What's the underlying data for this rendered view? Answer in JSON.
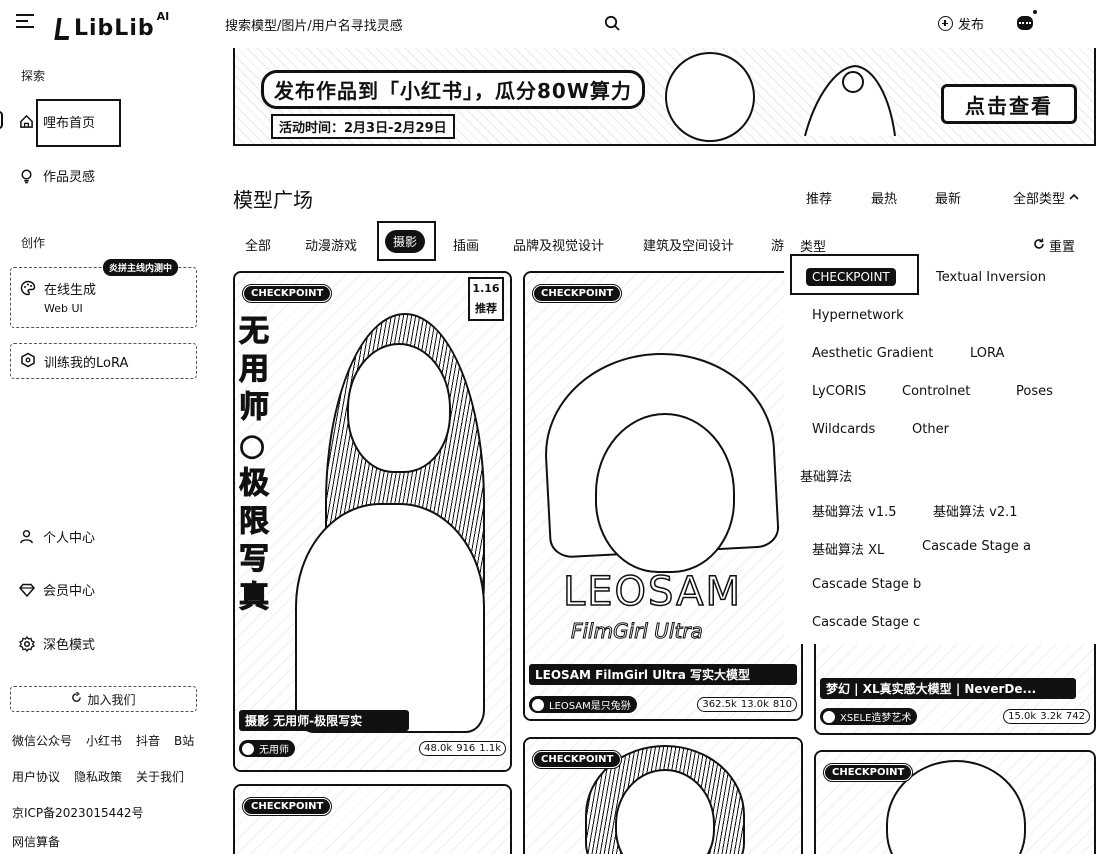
{
  "header": {
    "logo_text": "LibLib",
    "logo_sup": "AI",
    "search_placeholder": "搜索模型/图片/用户名寻找灵感",
    "publish_label": "发布"
  },
  "sidebar": {
    "explore_label": "探索",
    "home_label": "哩布首页",
    "inspiration_label": "作品灵感",
    "create_label": "创作",
    "gen_badge": "炎拼主线内测中",
    "gen_title": "在线生成",
    "gen_sub": "Web UI",
    "lora_label": "训练我的LoRA",
    "personal_label": "个人中心",
    "member_label": "会员中心",
    "dark_mode_label": "深色模式",
    "join_label": "加入我们",
    "footer_row1": [
      "微信公众号",
      "小红书",
      "抖音",
      "B站"
    ],
    "footer_row2": [
      "用户协议",
      "隐私政策",
      "关于我们"
    ],
    "icp": "京ICP备2023015442号",
    "net": "网信算备"
  },
  "banner": {
    "title": "发布作品到「小红书」，瓜分80W算力",
    "date": "活动时间：2月3日-2月29日",
    "cta": "点击查看"
  },
  "main": {
    "title": "模型广场",
    "sort_tabs": [
      "推荐",
      "最热",
      "最新"
    ],
    "all_types_label": "全部类型",
    "categories": [
      "全部",
      "动漫游戏",
      "摄影",
      "插画",
      "品牌及视觉设计",
      "建筑及空间设计",
      "游"
    ]
  },
  "cards": [
    {
      "badge": "CHECKPOINT",
      "corner": "1.16 推荐",
      "vertical_text": "无用师○极限写真",
      "title": "摄影 无用师-极限写实",
      "author": "无用师",
      "stats": [
        "48.0k",
        "916",
        "1.1k"
      ]
    },
    {
      "badge": "CHECKPOINT",
      "logo": "LEOSAM",
      "logo_sub": "FilmGirl Ultra",
      "title": "LEOSAM FilmGirl Ultra 写实大模型",
      "author": "LEOSAM是只兔狲",
      "stats": [
        "362.5k",
        "13.0k",
        "810"
      ]
    },
    {
      "title": "梦幻 | XL真实感大模型 | NeverDe...",
      "author": "XSELE造梦艺术",
      "stats": [
        "15.0k",
        "3.2k",
        "742"
      ]
    },
    {
      "badge": "CHECKPOINT"
    },
    {
      "badge": "CHECKPOINT"
    },
    {
      "badge": "CHECKPOINT"
    }
  ],
  "filter": {
    "type_label": "类型",
    "reset_label": "重置",
    "types": [
      "CHECKPOINT",
      "Textual Inversion",
      "Hypernetwork",
      "Aesthetic Gradient",
      "LORA",
      "LyCORIS",
      "Controlnet",
      "Poses",
      "Wildcards",
      "Other"
    ],
    "base_label": "基础算法",
    "bases": [
      "基础算法 v1.5",
      "基础算法 v2.1",
      "基础算法 XL",
      "Cascade Stage a",
      "Cascade Stage b",
      "Cascade Stage c"
    ]
  },
  "colors": {
    "ink": "#111111",
    "paper": "#ffffff"
  }
}
